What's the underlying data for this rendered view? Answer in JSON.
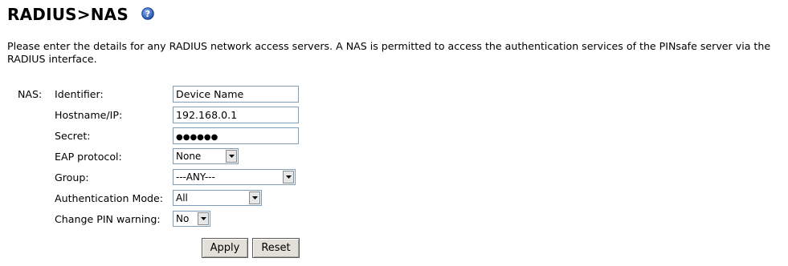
{
  "page": {
    "title": "RADIUS>NAS",
    "help_icon": "question-mark-icon",
    "intro": "Please enter the details for any RADIUS network access servers. A NAS is permitted to access the authentication services of the PINsafe server via the RADIUS interface."
  },
  "form": {
    "section_label": "NAS:",
    "identifier": {
      "label": "Identifier:",
      "value": "Device Name"
    },
    "hostname": {
      "label": "Hostname/IP:",
      "value": "192.168.0.1"
    },
    "secret": {
      "label": "Secret:",
      "value": "●●●●●●"
    },
    "eap": {
      "label": "EAP protocol:",
      "selected": "None"
    },
    "group": {
      "label": "Group:",
      "selected": "---ANY---"
    },
    "auth_mode": {
      "label": "Authentication Mode:",
      "selected": "All"
    },
    "change_pin": {
      "label": "Change PIN warning:",
      "selected": "No"
    }
  },
  "buttons": {
    "apply": "Apply",
    "reset": "Reset"
  },
  "colors": {
    "help_icon": "#2a5bbf",
    "field_border": "#7f9db9",
    "button_face": "#e2e0d8"
  }
}
